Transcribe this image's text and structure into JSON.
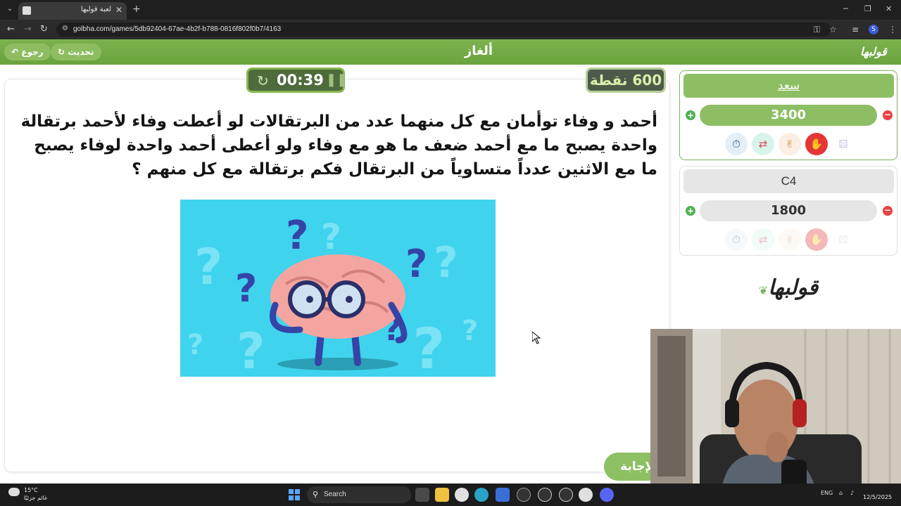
{
  "browser": {
    "tab_title": "لعبة قولبها",
    "url": "golbha.com/games/5db92404-67ae-4b2f-b788-0816f802f0b7/4163"
  },
  "header": {
    "back_label": "رجوع",
    "refresh_label": "تحديث",
    "title": "ألغاز"
  },
  "game": {
    "timer": "00:39",
    "points": "600 نقطة",
    "question": "أحمد و وفاء توأمان مع كل منهما عدد من البرتقالات لو أعطت وفاء لأحمد برتقالة واحدة يصبح ما مع أحمد ضعف ما هو مع وفاء ولو أعطى أحمد واحدة لوفاء يصبح ما مع الاثنين عدداً متساوياً من البرتقال فكم برتقالة مع كل منهم ؟",
    "answer_label": "الإجابة"
  },
  "teams": [
    {
      "name": "سعد",
      "score": "3400",
      "active": true
    },
    {
      "name": "C4",
      "score": "1800",
      "active": false
    }
  ],
  "lifelines": [
    "stopwatch-icon",
    "swap-icon",
    "peace-hand-icon",
    "stop-hand-icon",
    "dice-icon"
  ],
  "taskbar": {
    "temperature": "15°C",
    "weather_desc": "غائم جزئيًا",
    "search_label": "Search",
    "language": "ENG",
    "date": "12/5/2025"
  },
  "colors": {
    "brand_green": "#7ab25b",
    "timer_bg": "#4d6b3b",
    "points_text": "#d6f0a8",
    "remove_red": "#e84242",
    "add_green": "#4fb14f"
  }
}
